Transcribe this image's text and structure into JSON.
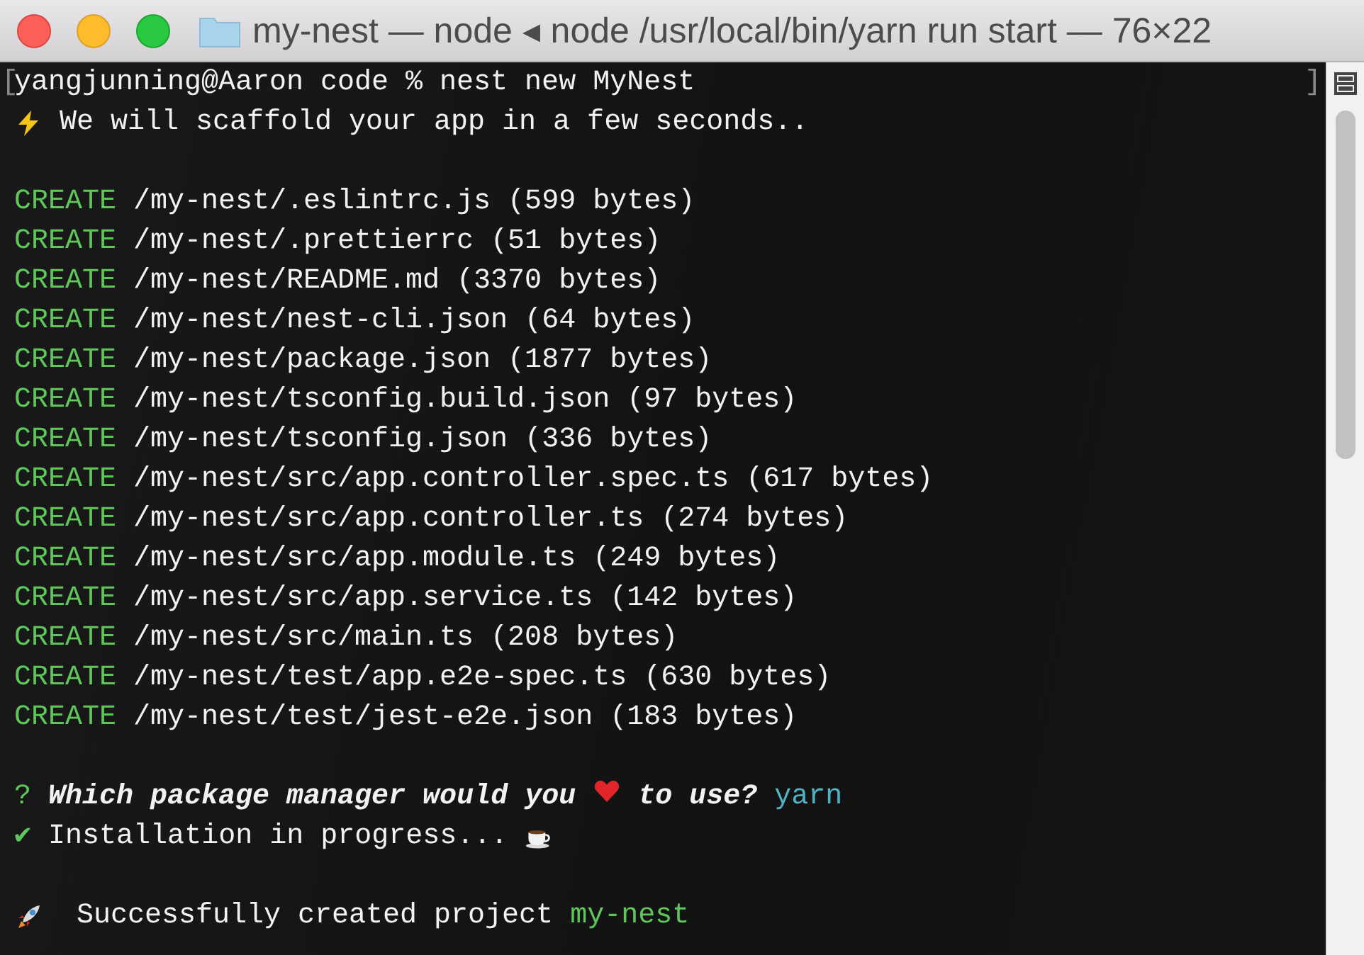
{
  "window": {
    "title": "my-nest — node ◂ node /usr/local/bin/yarn run start — 76×22"
  },
  "terminal": {
    "mark_left": "[",
    "mark_right": "]",
    "lines": [
      {
        "kind": "command",
        "text": "yangjunning@Aaron code % nest new MyNest"
      },
      {
        "kind": "notice",
        "text": "We will scaffold your app in a few seconds.."
      },
      {
        "kind": "blank"
      },
      {
        "kind": "create",
        "tag": "CREATE",
        "text": "/my-nest/.eslintrc.js (599 bytes)"
      },
      {
        "kind": "create",
        "tag": "CREATE",
        "text": "/my-nest/.prettierrc (51 bytes)"
      },
      {
        "kind": "create",
        "tag": "CREATE",
        "text": "/my-nest/README.md (3370 bytes)"
      },
      {
        "kind": "create",
        "tag": "CREATE",
        "text": "/my-nest/nest-cli.json (64 bytes)"
      },
      {
        "kind": "create",
        "tag": "CREATE",
        "text": "/my-nest/package.json (1877 bytes)"
      },
      {
        "kind": "create",
        "tag": "CREATE",
        "text": "/my-nest/tsconfig.build.json (97 bytes)"
      },
      {
        "kind": "create",
        "tag": "CREATE",
        "text": "/my-nest/tsconfig.json (336 bytes)"
      },
      {
        "kind": "create",
        "tag": "CREATE",
        "text": "/my-nest/src/app.controller.spec.ts (617 bytes)"
      },
      {
        "kind": "create",
        "tag": "CREATE",
        "text": "/my-nest/src/app.controller.ts (274 bytes)"
      },
      {
        "kind": "create",
        "tag": "CREATE",
        "text": "/my-nest/src/app.module.ts (249 bytes)"
      },
      {
        "kind": "create",
        "tag": "CREATE",
        "text": "/my-nest/src/app.service.ts (142 bytes)"
      },
      {
        "kind": "create",
        "tag": "CREATE",
        "text": "/my-nest/src/main.ts (208 bytes)"
      },
      {
        "kind": "create",
        "tag": "CREATE",
        "text": "/my-nest/test/app.e2e-spec.ts (630 bytes)"
      },
      {
        "kind": "create",
        "tag": "CREATE",
        "text": "/my-nest/test/jest-e2e.json (183 bytes)"
      },
      {
        "kind": "blank"
      },
      {
        "kind": "question",
        "tag": "?",
        "text": "Which package manager would you",
        "text_after": "to use?",
        "answer": "yarn"
      },
      {
        "kind": "progress",
        "tag": "✔",
        "text": "Installation in progress..."
      },
      {
        "kind": "blank"
      },
      {
        "kind": "success",
        "text": "Successfully created project",
        "answer": "my-nest"
      }
    ]
  }
}
